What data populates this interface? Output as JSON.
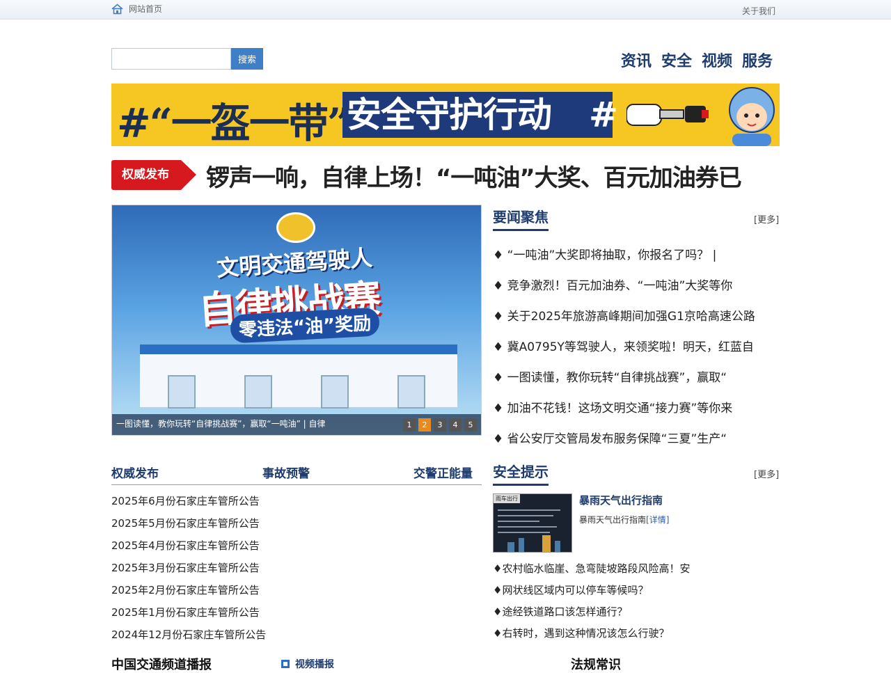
{
  "topbar": {
    "home_label": "网站首页",
    "about_label": "关于我们"
  },
  "search": {
    "placeholder": "",
    "button_label": "搜索"
  },
  "nav": [
    "资讯",
    "安全",
    "视频",
    "服务"
  ],
  "banner": {
    "part1": "#“一盔一带”",
    "part2": "安全守护行动",
    "part3": "#"
  },
  "headline": {
    "tag": "权威发布",
    "text": "锣声一响，自律上场！“一吨油”大奖、百元加油券已"
  },
  "slider": {
    "title_line1": "文明交通驾驶人",
    "title_line2": "自律挑战赛",
    "title_line3": "零违法“油”奖励",
    "caption": "一图读懂，教你玩转“自律挑战赛”，赢取“一吨油” | 自律",
    "pages": [
      "1",
      "2",
      "3",
      "4",
      "5"
    ],
    "active_page": 2
  },
  "focus": {
    "title": "要闻聚焦",
    "more": "[更多]",
    "items": [
      "♦ “一吨油”大奖即将抽取，你报名了吗？ |",
      "♦ 竞争激烈！百元加油券、“一吨油”大奖等你",
      "♦ 关于2025年旅游高峰期间加强G1京哈高速公路",
      "♦ 冀A0795Y等驾驶人，来领奖啦！明天，红蓝自",
      "♦ 一图读懂，教你玩转“自律挑战赛”，赢取“",
      "♦ 加油不花钱！这场文明交通“接力赛”等你来",
      "♦ 省公安厅交管局发布服务保障“三夏”生产“"
    ]
  },
  "notice_tabs": [
    "权威发布",
    "事故预警",
    "交警正能量"
  ],
  "notices": [
    "2025年6月份石家庄车管所公告",
    "2025年5月份石家庄车管所公告",
    "2025年4月份石家庄车管所公告",
    "2025年3月份石家庄车管所公告",
    "2025年2月份石家庄车管所公告",
    "2025年1月份石家庄车管所公告",
    "2024年12月份石家庄车管所公告"
  ],
  "safety": {
    "title": "安全提示",
    "more": "[更多]",
    "thumb_label": "雨车出行",
    "feature_title": "暴雨天气出行指南",
    "feature_desc": "暴雨天气出行指南",
    "feature_link": "[详情]",
    "items": [
      "♦农村临水临崖、急弯陡坡路段风险高！安",
      "♦网状线区域内可以停车等候吗？",
      "♦途经铁道路口该怎样通行？",
      "♦右转时，遇到这种情况该怎么行驶？"
    ]
  },
  "bottom": {
    "left_title": "中国交通频道播报",
    "video_label": "视频播报",
    "right_title": "法规常识"
  }
}
